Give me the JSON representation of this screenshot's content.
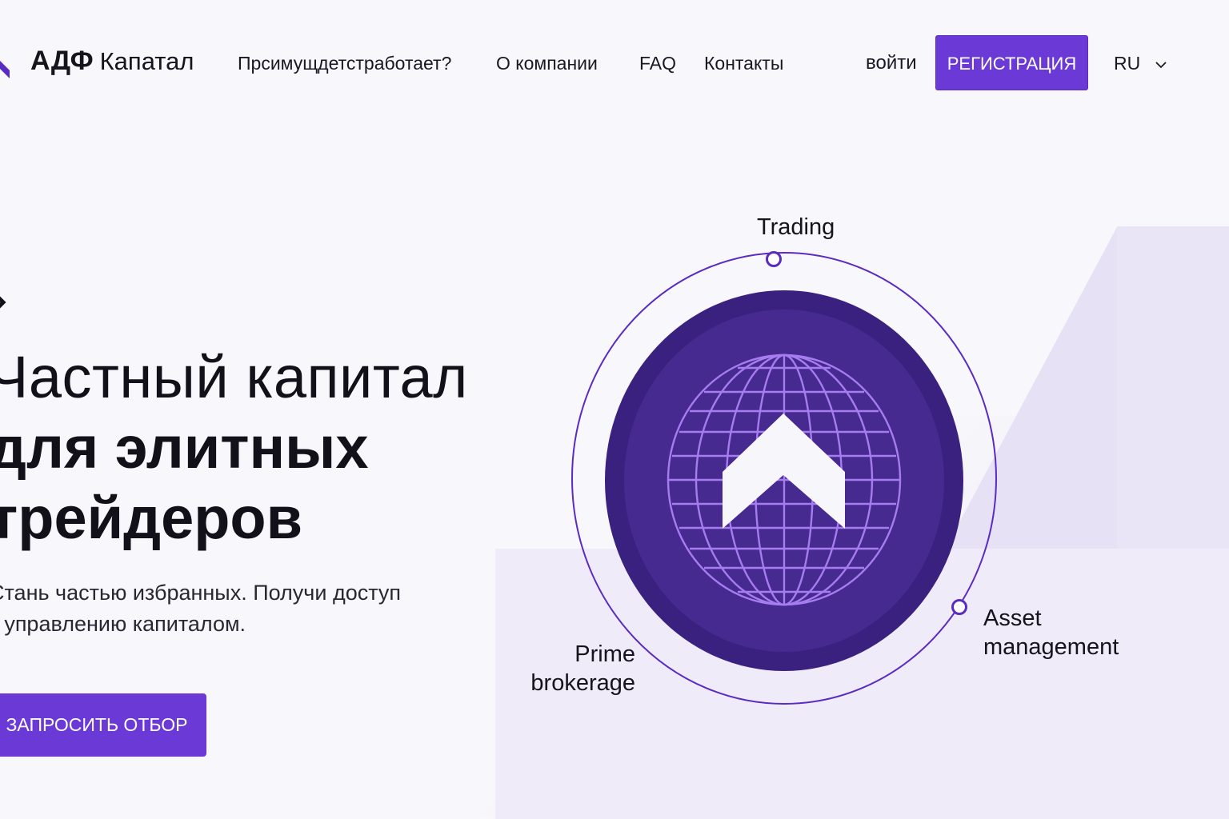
{
  "colors": {
    "accent": "#6b3ad6",
    "accent_dark": "#3a2180",
    "globe_line": "#a67cf0",
    "background": "#f8f7fb"
  },
  "header": {
    "logo": {
      "icon": "arrow-up-logo-icon",
      "name_bold": "АДФ",
      "name_light": "Капатал"
    },
    "nav": [
      {
        "label": "Прсимущдетстработает?"
      },
      {
        "label": "О компании"
      },
      {
        "label": "FAQ"
      },
      {
        "label": "Контакты"
      }
    ],
    "login_label": "войти",
    "register_label": "РЕГИСТРАЦИЯ",
    "language": {
      "selected": "RU",
      "icon": "chevron-down-icon"
    }
  },
  "hero": {
    "title_line1": "Частный капитал",
    "title_line2": "для элитных",
    "title_line3": "трейдеров",
    "subtitle_line1": "Стань частью избранных. Получи доступ",
    "subtitle_line2": "к управлению капиталом.",
    "cta_label": "ЗАПРОСИТЬ ОТБОР"
  },
  "diagram": {
    "center_icon": "globe-arrow-up-icon",
    "nodes": [
      {
        "label_lines": [
          "Trading"
        ]
      },
      {
        "label_lines": [
          "Prime",
          "brokerage"
        ]
      },
      {
        "label_lines": [
          "Asset",
          "management"
        ]
      }
    ]
  }
}
